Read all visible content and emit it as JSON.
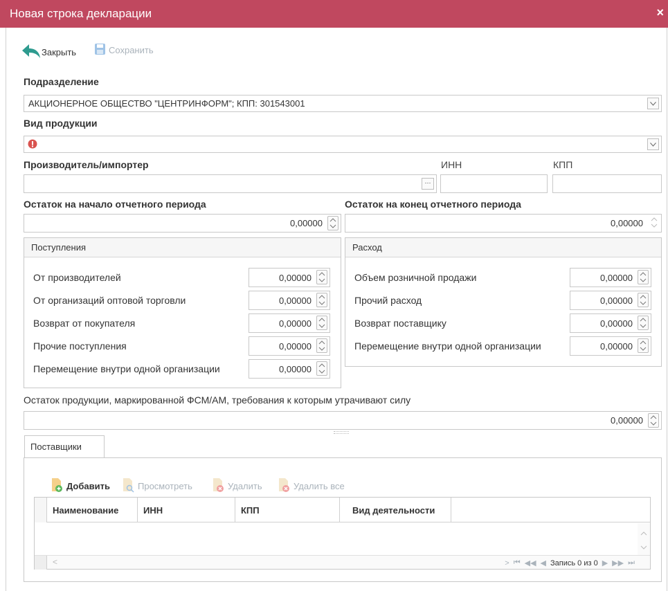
{
  "window": {
    "title": "Новая строка декларации",
    "close_glyph": "×"
  },
  "toolbar": {
    "close_label": "Закрыть",
    "save_label": "Сохранить"
  },
  "subdivision": {
    "label": "Подразделение",
    "value": "АКЦИОНЕРНОЕ ОБЩЕСТВО \"ЦЕНТРИНФОРМ\"; КПП: 301543001"
  },
  "product_type": {
    "label": "Вид продукции",
    "value": ""
  },
  "producer": {
    "label": "Производитель/импортер",
    "value": "",
    "browse_glyph": "···",
    "inn_label": "ИНН",
    "kpp_label": "КПП",
    "inn_value": "",
    "kpp_value": ""
  },
  "balance_start": {
    "label": "Остаток на начало отчетного периода",
    "value": "0,00000"
  },
  "balance_end": {
    "label": "Остаток на конец отчетного периода",
    "value": "0,00000"
  },
  "receipts": {
    "title": "Поступления",
    "rows": [
      {
        "label": "От производителей",
        "value": "0,00000"
      },
      {
        "label": "От организаций оптовой торговли",
        "value": "0,00000"
      },
      {
        "label": "Возврат от покупателя",
        "value": "0,00000"
      },
      {
        "label": "Прочие поступления",
        "value": "0,00000"
      },
      {
        "label": "Перемещение внутри одной организации",
        "value": "0,00000"
      }
    ]
  },
  "expense": {
    "title": "Расход",
    "rows": [
      {
        "label": "Объем розничной продажи",
        "value": "0,00000"
      },
      {
        "label": "Прочий расход",
        "value": "0,00000"
      },
      {
        "label": "Возврат поставщику",
        "value": "0,00000"
      },
      {
        "label": "Перемещение внутри одной организации",
        "value": "0,00000"
      }
    ]
  },
  "marked_balance": {
    "label": "Остаток продукции, маркированной ФСМ/АМ, требования к которым утрачивают силу",
    "value": "0,00000"
  },
  "suppliers": {
    "tab_label": "Поставщики",
    "toolbar": {
      "add": "Добавить",
      "view": "Просмотреть",
      "delete": "Удалить",
      "delete_all": "Удалить все"
    },
    "columns": [
      "Наименование",
      "ИНН",
      "КПП",
      "Вид деятельности"
    ],
    "rows": [],
    "pager_text": "Запись 0 из 0"
  },
  "colors": {
    "titlebar": "#c0485f",
    "close_arrow": "#2e9b8f",
    "error_icon": "#d9534f",
    "add_icon": "#f0a030"
  }
}
